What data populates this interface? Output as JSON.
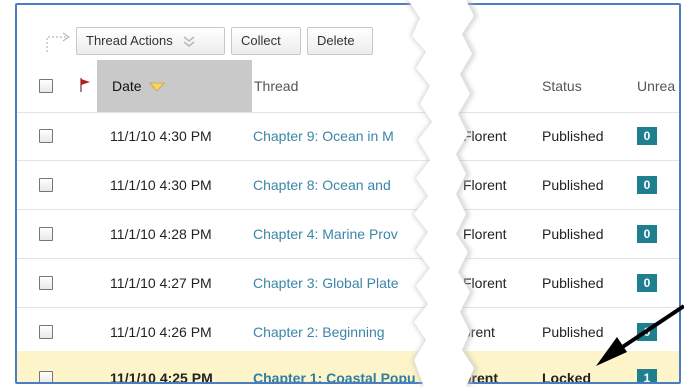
{
  "toolbar": {
    "thread_actions_label": "Thread Actions",
    "collect_label": "Collect",
    "delete_label": "Delete"
  },
  "table": {
    "columns": {
      "date": "Date",
      "thread": "Thread",
      "status": "Status",
      "unread": "Unrea"
    },
    "rows": [
      {
        "date": "11/1/10 4:30 PM",
        "thread": "Chapter 9: Ocean in M",
        "author": "Florent",
        "status": "Published",
        "unread": "0"
      },
      {
        "date": "11/1/10 4:30 PM",
        "thread": "Chapter 8: Ocean and",
        "author": "Florent",
        "status": "Published",
        "unread": "0"
      },
      {
        "date": "11/1/10 4:28 PM",
        "thread": "Chapter 4: Marine Prov",
        "author": "Florent",
        "status": "Published",
        "unread": "0"
      },
      {
        "date": "11/1/10 4:27 PM",
        "thread": "Chapter 3: Global Plate",
        "author": "Florent",
        "status": "Published",
        "unread": "0"
      },
      {
        "date": "11/1/10 4:26 PM",
        "thread": "Chapter 2: Beginning",
        "author": "orent",
        "status": "Published",
        "unread": "0"
      },
      {
        "date": "11/1/10 4:25 PM",
        "thread": "Chapter 1: Coastal Popu",
        "author": "orent",
        "status": "Locked",
        "unread": "1"
      }
    ]
  },
  "colors": {
    "frame_border": "#4a7dc4",
    "link": "#3a86a8",
    "badge": "#1f7f8f",
    "highlight_row": "#fdf5c9",
    "sorted_header": "#c9c9c9",
    "flag": "#b02020",
    "sort_arrow": "#f0c419"
  },
  "icons": {
    "toolbar_arrow": "corner-arrow-icon",
    "dropdown": "double-chevron-down-icon",
    "flag": "flag-icon",
    "sort": "sort-down-triangle-icon",
    "annotation": "callout-arrow-icon"
  }
}
